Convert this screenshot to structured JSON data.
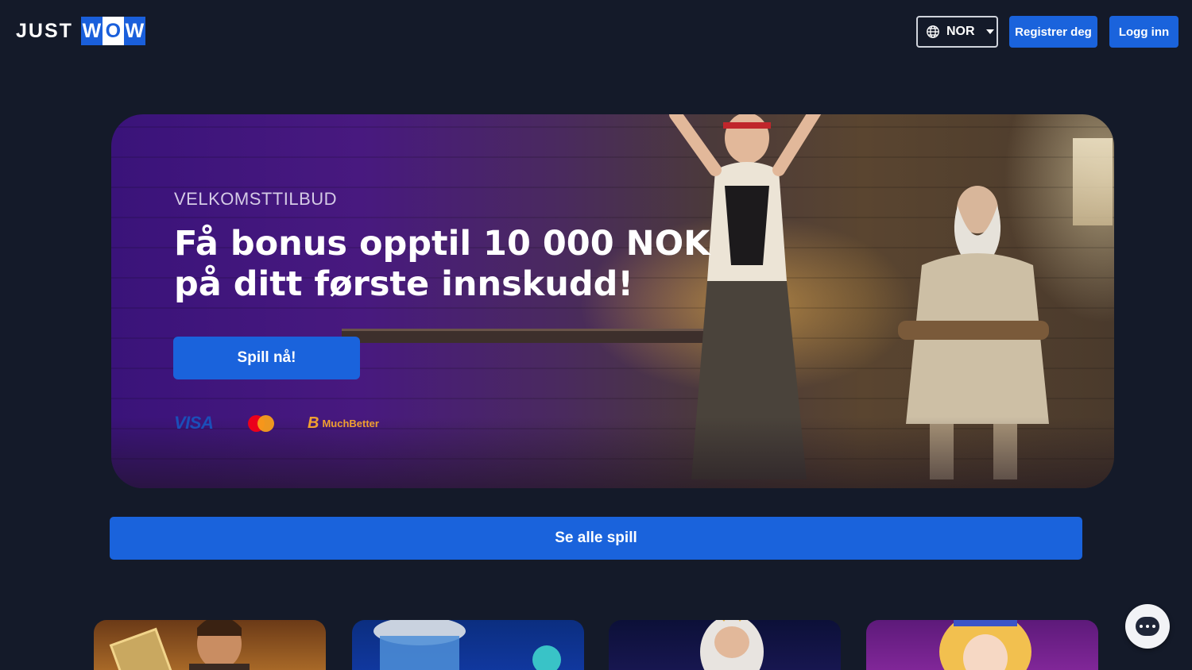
{
  "header": {
    "logo_part1": "JUST",
    "logo_letters": [
      "W",
      "O",
      "W"
    ],
    "language": {
      "icon": "globe-icon",
      "code": "NOR"
    },
    "register_label": "Registrer deg",
    "login_label": "Logg inn"
  },
  "hero": {
    "eyebrow": "VELKOMSTTILBUD",
    "title_line1": "Få bonus opptil 10 000  NOK",
    "title_line2": "på ditt første innskudd!",
    "cta_label": "Spill nå!",
    "payments": {
      "visa": "VISA",
      "mastercard": "mastercard-icon",
      "muchbetter": "MuchBetter"
    }
  },
  "games": {
    "see_all_label": "Se alle spill"
  },
  "chat": {
    "icon": "chat-icon"
  },
  "colors": {
    "background": "#141a29",
    "accent": "#1a63dc"
  }
}
